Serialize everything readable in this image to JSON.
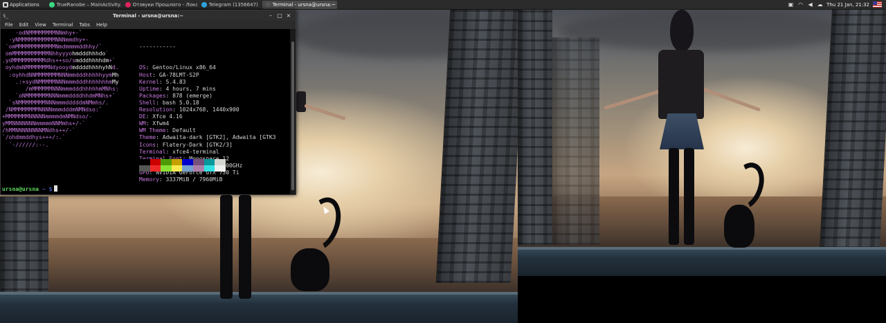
{
  "panel": {
    "applications_label": "Applications",
    "tasks": [
      {
        "label": "TrueRanobe – MainActivity...",
        "icon_color": "#3ddc84",
        "active": false
      },
      {
        "label": "Отзвуки Прошлого - Лока...",
        "icon_color": "#e0245e",
        "active": false
      },
      {
        "label": "Telegram (1356647)",
        "icon_color": "#2ca5e0",
        "active": false
      },
      {
        "label": "Terminal - ursna@ursna:~",
        "icon_color": "#555555",
        "active": true
      }
    ],
    "clock": "Thu 21 Jan, 21:32",
    "tray_icons": [
      "screenshot-icon",
      "wifi-icon",
      "volume-icon",
      "weather-icon"
    ]
  },
  "terminal": {
    "title": "Terminal - ursna@ursna:~",
    "menu": [
      "File",
      "Edit",
      "View",
      "Terminal",
      "Tabs",
      "Help"
    ],
    "separator": "-----------",
    "info": [
      {
        "key": "OS",
        "value": "Gentoo/Linux x86_64"
      },
      {
        "key": "Host",
        "value": "GA-78LMT-S2P"
      },
      {
        "key": "Kernel",
        "value": "5.4.83"
      },
      {
        "key": "Uptime",
        "value": "4 hours, 7 mins"
      },
      {
        "key": "Packages",
        "value": "878 (emerge)"
      },
      {
        "key": "Shell",
        "value": "bash 5.0.18"
      },
      {
        "key": "Resolution",
        "value": "1024x768, 1440x900"
      },
      {
        "key": "DE",
        "value": "Xfce 4.16"
      },
      {
        "key": "WM",
        "value": "Xfwm4"
      },
      {
        "key": "WM Theme",
        "value": "Default"
      },
      {
        "key": "Theme",
        "value": "Adwaita-dark [GTK2], Adwaita [GTK3"
      },
      {
        "key": "Icons",
        "value": "Flatery-Dark [GTK2/3]"
      },
      {
        "key": "Terminal",
        "value": "xfce4-terminal"
      },
      {
        "key": "Terminal Font",
        "value": "Monospace 12"
      },
      {
        "key": "CPU",
        "value": "AMD FX-6350 (6) @ 3.100GHz"
      },
      {
        "key": "GPU",
        "value": "NVIDIA GeForce GTX 750 Ti"
      },
      {
        "key": "Memory",
        "value": "3337MiB / 7960MiB"
      }
    ],
    "palette_dark": [
      "#000000",
      "#cc0000",
      "#4e9a06",
      "#c4a000",
      "#0000cc",
      "#75507b",
      "#06989a",
      "#d3d7cf"
    ],
    "palette_bright": [
      "#555753",
      "#ef2929",
      "#8ae234",
      "#fce94f",
      "#729fcf",
      "#ad7fa8",
      "#34e2e2",
      "#eeeeec"
    ],
    "prompt_user": "ursna@ursna",
    "prompt_path": "~",
    "prompt_symbol": "$",
    "logo_lines": [
      [
        [
          "    -odNMMMMMMMMNNmhy+-",
          "p"
        ],
        [
          "`",
          "w"
        ]
      ],
      [
        [
          "  -yNMMMMMMMMMMMNNNmmdhy+-",
          "p"
        ]
      ],
      [
        [
          " `omMMMMMMMMMMMMNmdmmmmddhhy/`",
          "p"
        ]
      ],
      [
        [
          " omMMMMMMMMMMMNhhyyyo",
          "p"
        ],
        [
          "hmdddhhhdo",
          "w"
        ],
        [
          "`",
          "p"
        ]
      ],
      [
        [
          ".ydMMMMMMMMMMdhs++so/s",
          "p"
        ],
        [
          "mdddhhhhdm",
          "w"
        ],
        [
          "+`",
          "p"
        ]
      ],
      [
        [
          " oyhdmNMMMMMMMNdyooyd",
          "p"
        ],
        [
          "mddddhhhhyhN",
          "w"
        ],
        [
          "d.",
          "p"
        ]
      ],
      [
        [
          "  :oyhhdNNMMMMMMMNNNmmdddhhhhhyym",
          "p"
        ],
        [
          "Mh",
          "w"
        ]
      ],
      [
        [
          "    .:+sydNMMMMMNNNmmmdddhhhhhhhm",
          "p"
        ],
        [
          "My",
          "w"
        ]
      ],
      [
        [
          "       /mMMMMMMNNNmmmdddhhhhhmMNhs:",
          "p"
        ]
      ],
      [
        [
          "    `oNMMMMMMMNNNmmmddddhhdmMNhs+`",
          "p"
        ]
      ],
      [
        [
          "  `sNMMMMMMMMNNNmmmdddddmNMmhs/.",
          "p"
        ]
      ],
      [
        [
          " /NMMMMMMMMNNNNmmmdddmNMNdso:",
          "p"
        ],
        [
          "`",
          "w"
        ]
      ],
      [
        [
          "+MMMMMMMNNNNNmmmmdmNMNdso/-",
          "p"
        ]
      ],
      [
        [
          "yMMNNNNNNNmmmmmNNMmhs+/-`",
          "p"
        ]
      ],
      [
        [
          "/hMMNNNNNNNNMNdhs++/-`",
          "p"
        ]
      ],
      [
        [
          "`/ohdmmddhys+++/:.`",
          "p"
        ]
      ],
      [
        [
          "  `-//////:--.",
          "p"
        ]
      ]
    ]
  }
}
